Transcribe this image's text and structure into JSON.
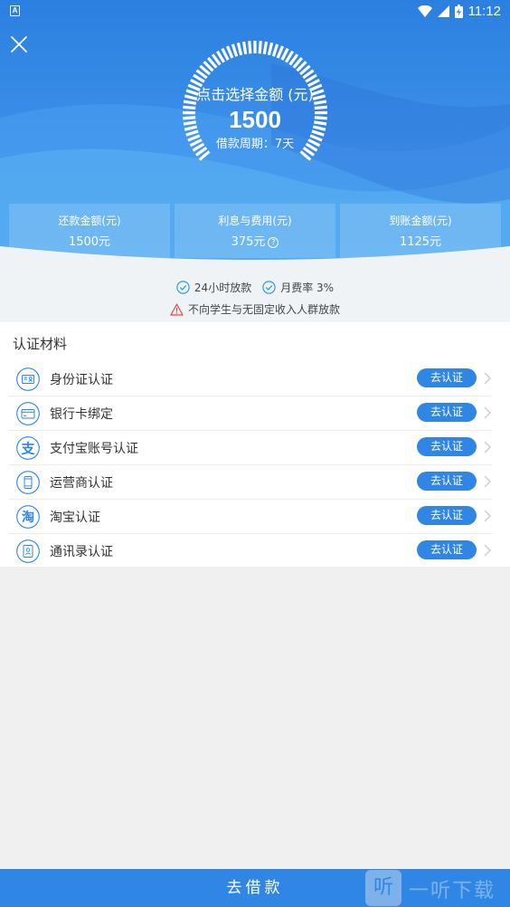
{
  "status": {
    "left_glyph": "A",
    "time": "11:12"
  },
  "loan": {
    "prompt": "点击选择金额 (元)",
    "amount": "1500",
    "period": "借款周期：7天"
  },
  "summary": [
    {
      "label": "还款金额(元)",
      "value": "1500元"
    },
    {
      "label": "利息与费用(元)",
      "value": "375元",
      "help": "?"
    },
    {
      "label": "到账金额(元)",
      "value": "1125元"
    }
  ],
  "notices": {
    "item1": "24小时放款",
    "item2": "月费率 3%",
    "warning": "不向学生与无固定收入人群放款"
  },
  "cert": {
    "title": "认证材料",
    "button_label": "去认证",
    "items": [
      {
        "label": "身份证认证",
        "icon": "id-card-icon"
      },
      {
        "label": "银行卡绑定",
        "icon": "bank-card-icon"
      },
      {
        "label": "支付宝账号认证",
        "icon": "alipay-icon",
        "glyph": "支"
      },
      {
        "label": "运营商认证",
        "icon": "phone-icon"
      },
      {
        "label": "淘宝认证",
        "icon": "taobao-icon",
        "glyph": "淘"
      },
      {
        "label": "通讯录认证",
        "icon": "contacts-icon"
      }
    ]
  },
  "bottom": {
    "label": "去借款"
  },
  "watermark": {
    "box_glyph": "听",
    "text": "一听下载"
  },
  "colors": {
    "accent": "#2f86e5",
    "hero_top": "#2b7fe0",
    "hero_bottom": "#4ea6ef",
    "warning": "#e5483f"
  }
}
